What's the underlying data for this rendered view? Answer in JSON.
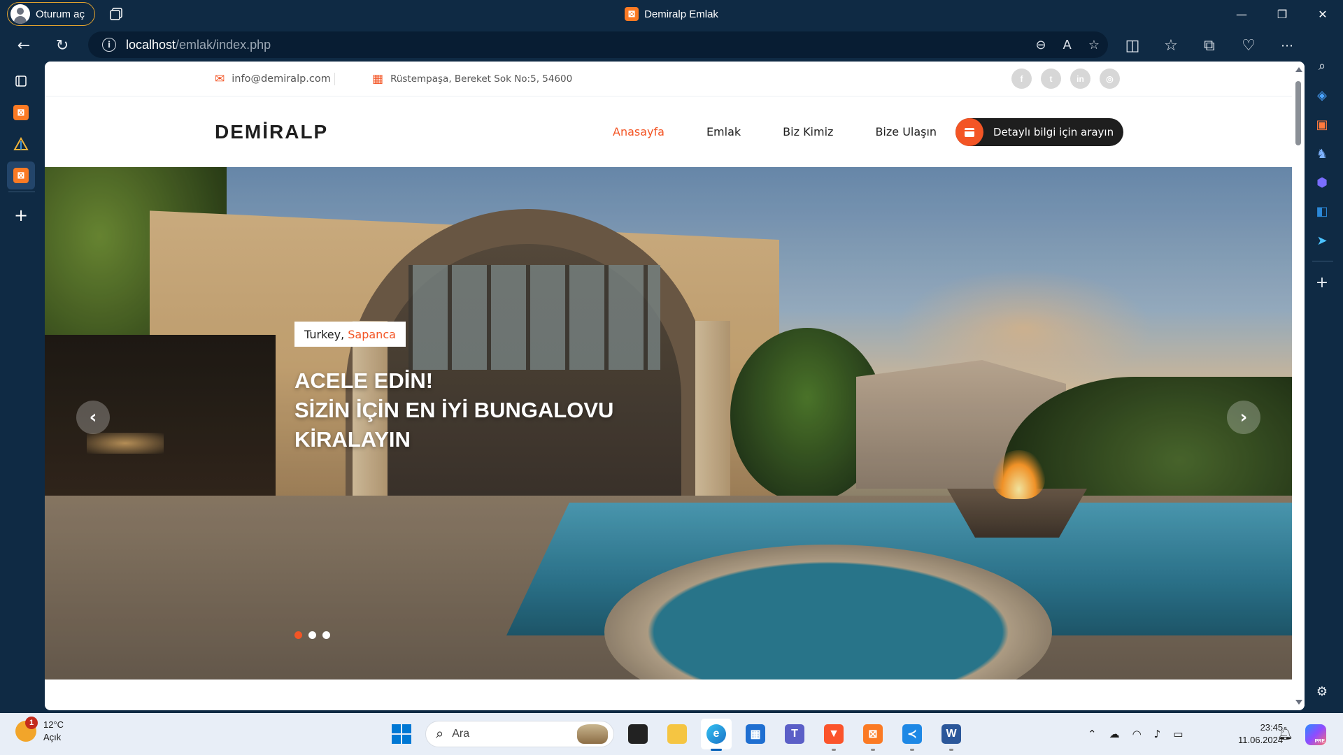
{
  "browser": {
    "profile_label": "Oturum aç",
    "window_title": "Demiralp Emlak",
    "tab_favicon_letter": "⊠",
    "url_host": "localhost",
    "url_path": "/emlak/index.php",
    "icons": [
      "back-icon",
      "refresh-icon",
      "info-icon",
      "zoom-icon",
      "read-aloud-icon",
      "favorite-star-icon",
      "split-screen-icon",
      "favorites-icon",
      "collections-icon",
      "performance-icon",
      "more-icon",
      "copilot-icon"
    ],
    "window_controls": {
      "minimize": "—",
      "maximize": "❐",
      "close": "✕"
    }
  },
  "site": {
    "email": "info@demiralp.com",
    "address": "Rüstempaşa, Bereket Sok No:5, 54600",
    "socials": [
      "facebook",
      "twitter",
      "linkedin",
      "instagram"
    ],
    "logo": "DEMİRALP",
    "nav": [
      {
        "label": "Anasayfa",
        "active": true
      },
      {
        "label": "Emlak",
        "active": false
      },
      {
        "label": "Biz Kimiz",
        "active": false
      },
      {
        "label": "Bize Ulaşın",
        "active": false
      }
    ],
    "cta_label": "Detaylı bilgi için arayın",
    "hero": {
      "badge_prefix": "Turkey,",
      "badge_accent": "Sapanca",
      "headline_line1": "ACELE EDİN!",
      "headline_line2": "SİZİN İÇİN EN İYİ BUNGALOVU",
      "headline_line3": "KİRALAYIN",
      "slides_total": 3,
      "active_slide": 1,
      "prev_arrow": "‹",
      "next_arrow": "›"
    },
    "colors": {
      "accent": "#f35525",
      "dark": "#1e1e1e"
    }
  },
  "taskbar": {
    "temperature": "12°C",
    "weather_state": "Açık",
    "weather_notification": "1",
    "search_placeholder": "Ara",
    "time": "23:45",
    "date": "11.06.2024",
    "copilot_badge": "PRE",
    "pinned_apps": [
      "windows-start",
      "search",
      "task-view",
      "file-explorer",
      "edge",
      "microsoft-store",
      "teams",
      "brave",
      "xampp",
      "vscode",
      "word"
    ]
  }
}
